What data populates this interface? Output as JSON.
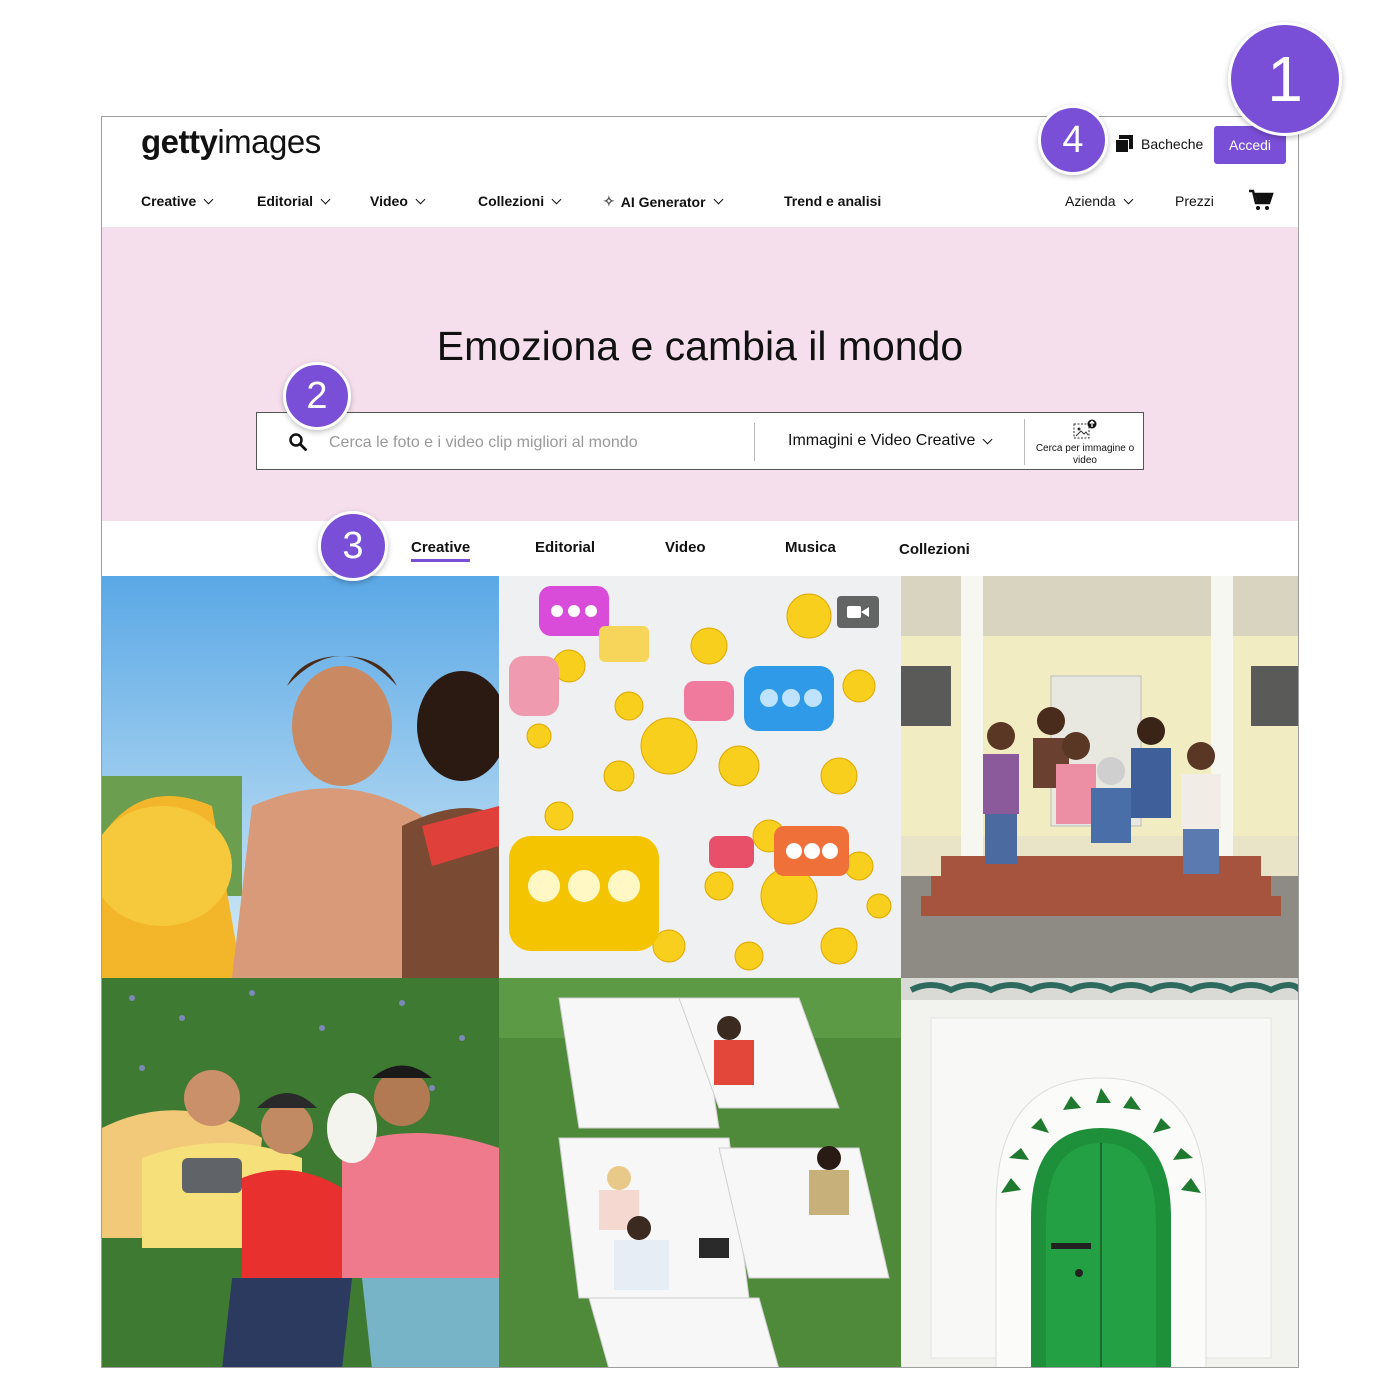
{
  "header": {
    "logo_bold": "getty",
    "logo_light": "images",
    "boards_label": "Bacheche",
    "login_label": "Accedi"
  },
  "nav": {
    "items": [
      {
        "label": "Creative"
      },
      {
        "label": "Editorial"
      },
      {
        "label": "Video"
      },
      {
        "label": "Collezioni"
      },
      {
        "label": "AI Generator"
      },
      {
        "label": "Trend e analisi"
      }
    ],
    "right_items": [
      {
        "label": "Azienda"
      },
      {
        "label": "Prezzi"
      }
    ],
    "cart_icon": "cart-icon"
  },
  "hero": {
    "title": "Emoziona e cambia il mondo",
    "background": "#f5dfec",
    "search": {
      "placeholder": "Cerca le foto e i video clip migliori al mondo",
      "type_selector": "Immagini e Video Creative",
      "image_search_label": "Cerca per immagine o video"
    }
  },
  "tabs": [
    {
      "label": "Creative",
      "active": true
    },
    {
      "label": "Editorial"
    },
    {
      "label": "Video"
    },
    {
      "label": "Musica"
    },
    {
      "label": "Collezioni"
    }
  ],
  "grid": {
    "tiles": [
      {
        "subject": "couple-pool-photo"
      },
      {
        "subject": "emoji-chat-bubbles-video",
        "video": true
      },
      {
        "subject": "family-porch-photo"
      },
      {
        "subject": "friends-lying-grass-photo"
      },
      {
        "subject": "students-study-tables-photo"
      },
      {
        "subject": "green-door-arch-photo"
      }
    ]
  },
  "markers": [
    "1",
    "2",
    "3",
    "4"
  ],
  "colors": {
    "accent": "#7a4fd8",
    "hero_bg": "#f5dfec"
  }
}
